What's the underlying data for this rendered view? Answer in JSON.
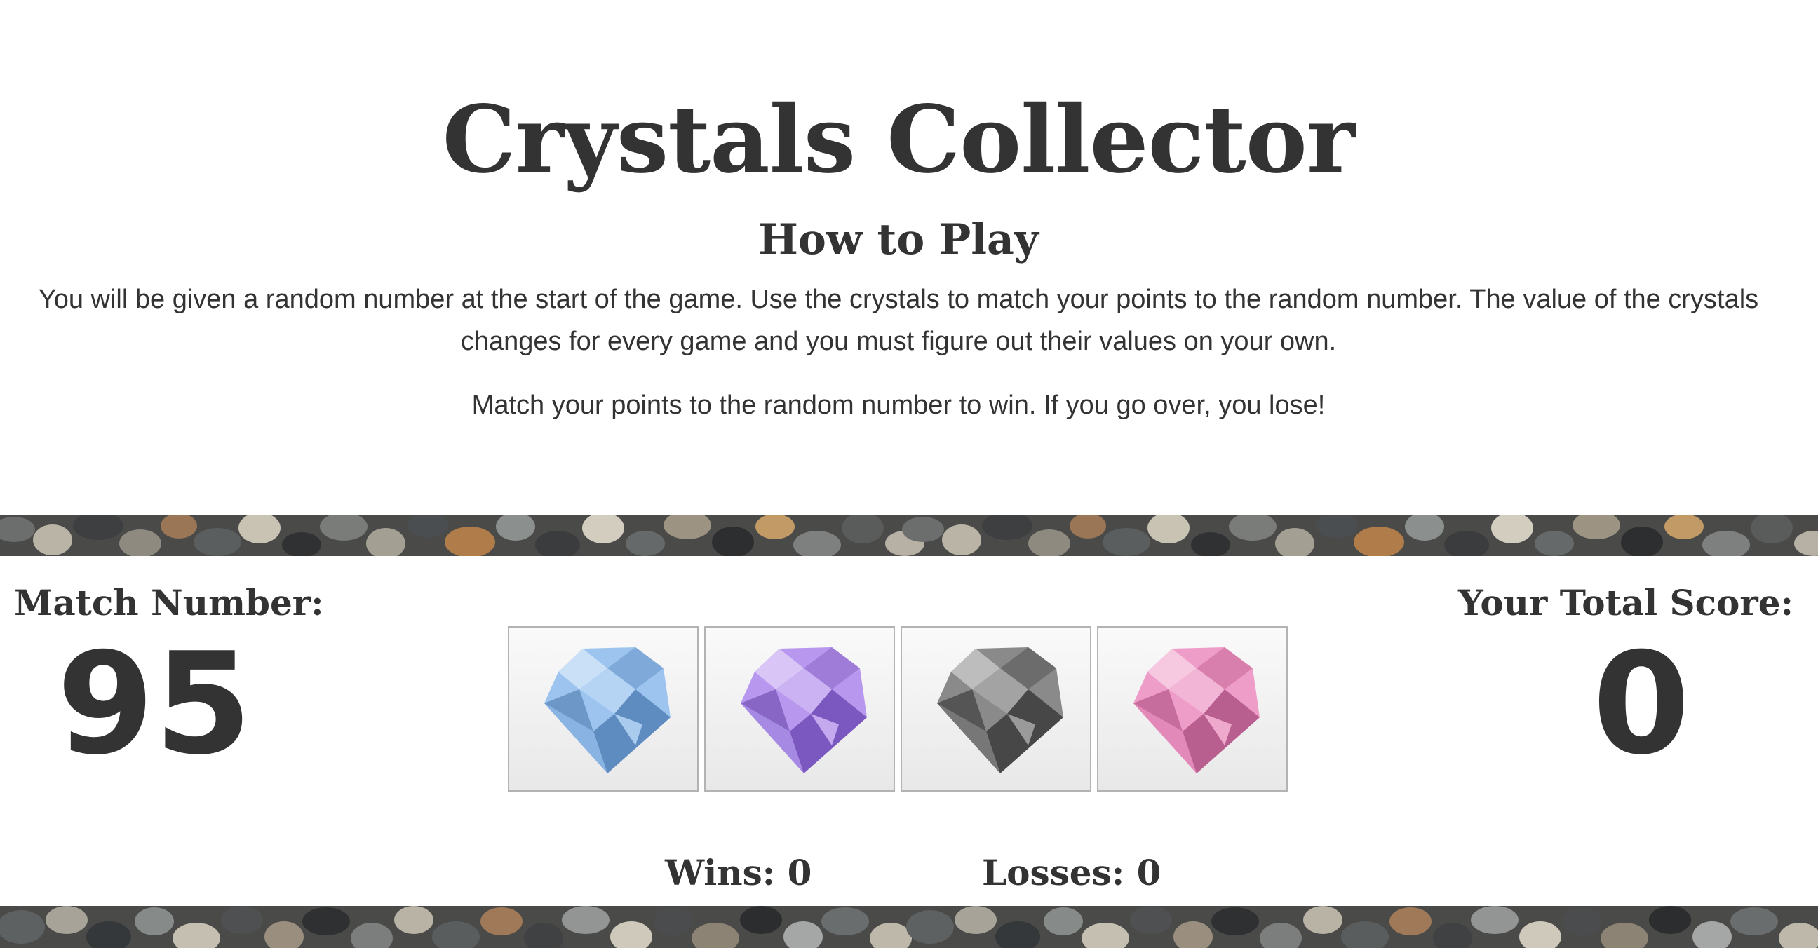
{
  "header": {
    "title": "Crystals Collector",
    "subtitle": "How to Play",
    "instructions": "You will be given a random number at the start of the game. Use the crystals to match your points to the random number. The value of the crystals changes for every game and you must figure out their values on your own.",
    "rule": "Match your points to the random number to win. If you go over, you lose!"
  },
  "game": {
    "match_label": "Match Number:",
    "match_value": "95",
    "score_label": "Your Total Score:",
    "score_value": "0",
    "crystals": [
      {
        "name": "blue",
        "color": "#9cc4ee"
      },
      {
        "name": "purple",
        "color": "#b897ee"
      },
      {
        "name": "gray",
        "color": "#8a8a8a"
      },
      {
        "name": "pink",
        "color": "#ee9cc8"
      }
    ],
    "wins_label": "Wins:",
    "wins_value": "0",
    "losses_label": "Losses:",
    "losses_value": "0"
  },
  "colors": {
    "text": "#333333",
    "background": "#ffffff"
  }
}
